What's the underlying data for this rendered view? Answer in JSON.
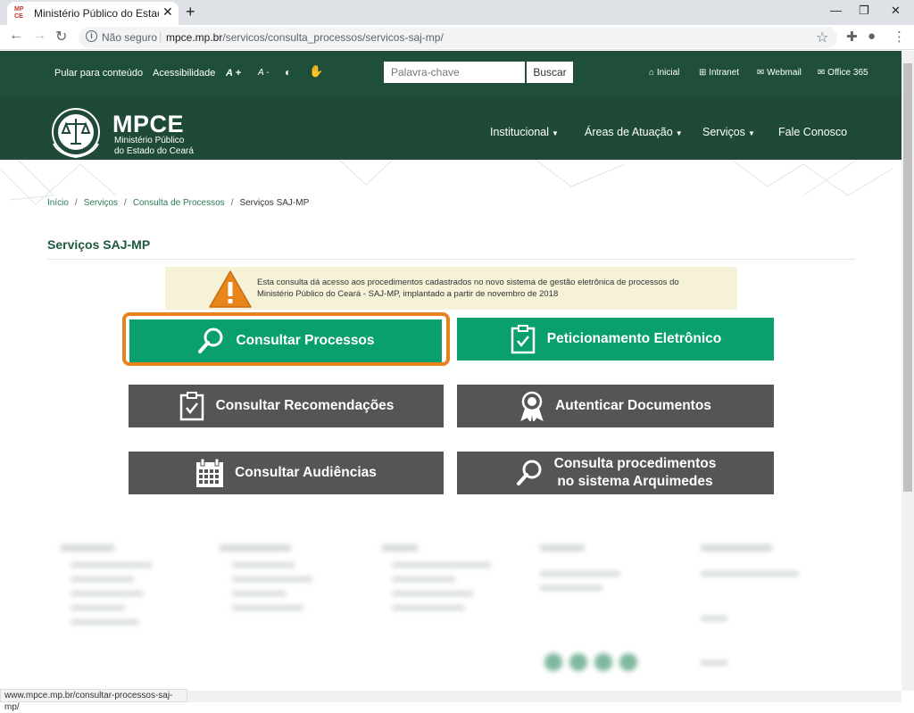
{
  "browser": {
    "tab_title": "Ministério Público do Estado do",
    "favicon_text": "MP CE",
    "security": "Não seguro",
    "url_domain": "mpce.mp.br",
    "url_path": "/servicos/consulta_processos/servicos-saj-mp/",
    "status_url": "www.mpce.mp.br/consultar-processos-saj-mp/"
  },
  "topbar": {
    "skip": "Pular para conteúdo",
    "accessibility": "Acessibilidade",
    "font_up": "A +",
    "font_down": "A -",
    "search_placeholder": "Palavra-chave",
    "search_btn": "Buscar",
    "links": [
      "Inicial",
      "Intranet",
      "Webmail",
      "Office 365"
    ]
  },
  "logo": {
    "name": "MPCE",
    "sub1": "Ministério Público",
    "sub2": "do Estado do Ceará"
  },
  "nav": [
    "Institucional",
    "Áreas de Atuação",
    "Serviços",
    "Fale Conosco"
  ],
  "breadcrumb": [
    "Início",
    "Serviços",
    "Consulta de Processos",
    "Serviços SAJ-MP"
  ],
  "page_title": "Serviços SAJ-MP",
  "notice": "Esta consulta dá acesso aos procedimentos cadastrados no novo sistema de gestão eletrônica de processos do Ministério Público do Ceará - SAJ-MP, implantado a partir de novembro de 2018",
  "services": [
    {
      "label": "Consultar Processos",
      "icon": "search-icon"
    },
    {
      "label": "Peticionamento Eletrônico",
      "icon": "clipboard-check-icon"
    },
    {
      "label": "Consultar Recomendações",
      "icon": "clipboard-check-icon"
    },
    {
      "label": "Autenticar Documentos",
      "icon": "award-icon"
    },
    {
      "label": "Consultar Audiências",
      "icon": "calendar-icon"
    },
    {
      "label1": "Consulta procedimentos",
      "label2": "no sistema Arquimedes",
      "icon": "search-icon"
    }
  ],
  "colors": {
    "dark_green": "#1f4f3a",
    "button_green": "#0aa06e",
    "button_grey": "#555555",
    "highlight": "#e8821e",
    "notice_bg": "#f5f2d8"
  }
}
